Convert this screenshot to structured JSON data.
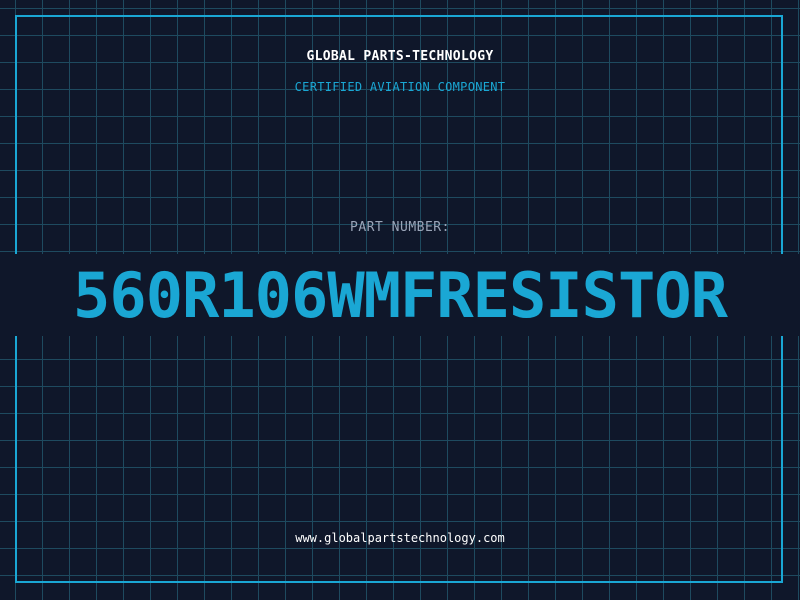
{
  "header": {
    "company": "GLOBAL PARTS-TECHNOLOGY",
    "subtitle": "CERTIFIED AVIATION COMPONENT"
  },
  "part": {
    "label": "PART NUMBER:",
    "number": "560R106WMFRESISTOR"
  },
  "footer": {
    "website": "www.globalpartstechnology.com"
  },
  "colors": {
    "background": "#0f172a",
    "grid": "#1e4a5f",
    "accent": "#1aa7d4",
    "text": "#ffffff",
    "muted": "#9aa5b8"
  }
}
